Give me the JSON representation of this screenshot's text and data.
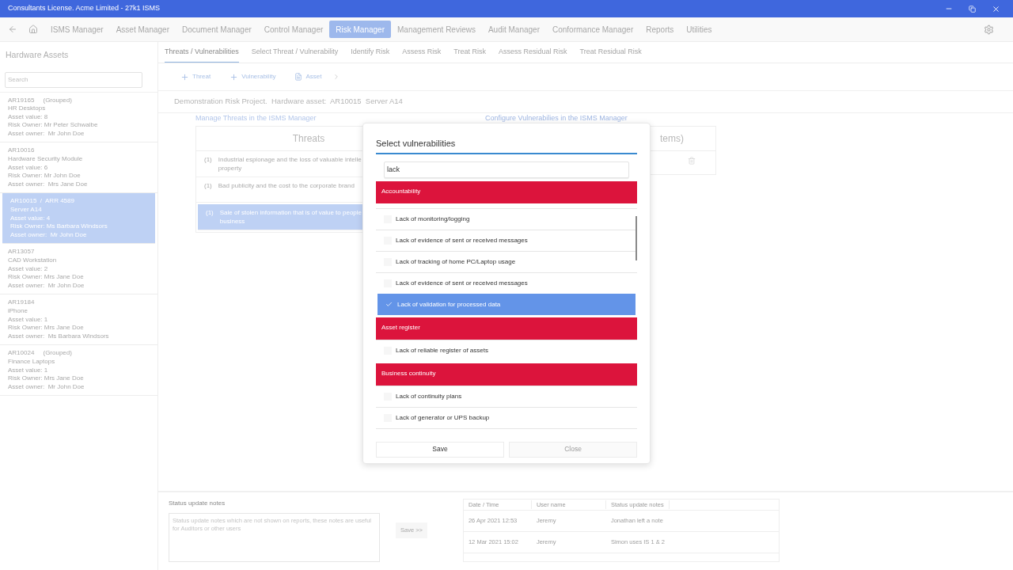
{
  "window": {
    "title": "Consultants License. Acme Limited - 27k1 ISMS"
  },
  "nav": [
    {
      "label": "ISMS Manager",
      "selected": false
    },
    {
      "label": "Asset Manager",
      "selected": false
    },
    {
      "label": "Document Manager",
      "selected": false
    },
    {
      "label": "Control Manager",
      "selected": false
    },
    {
      "label": "Risk Manager",
      "selected": true
    },
    {
      "label": "Management Reviews",
      "selected": false
    },
    {
      "label": "Audit Manager",
      "selected": false
    },
    {
      "label": "Conformance Manager",
      "selected": false
    },
    {
      "label": "Reports",
      "selected": false
    },
    {
      "label": "Utilities",
      "selected": false
    }
  ],
  "sidebar": {
    "title": "Hardware Assets",
    "search": {
      "placeholder": "Search"
    },
    "items": [
      {
        "lines": [
          "AR19165     (Grouped)",
          "HR Desktops",
          "Asset value: 8",
          "Risk Owner: Mr Peter Schwalbe",
          "Asset owner:  Mr John Doe"
        ],
        "selected": false
      },
      {
        "lines": [
          "AR10016",
          "Hardware Security Module",
          "Asset value: 6",
          "Risk Owner: Mr John Doe",
          "Asset owner:  Mrs Jane Doe"
        ],
        "selected": false
      },
      {
        "lines": [
          "AR10015  /  ARR 4589",
          "Server A14",
          "Asset value: 4",
          "Risk Owner: Ms Barbara Windsors",
          "Asset owner:  Mr John Doe"
        ],
        "selected": true
      },
      {
        "lines": [
          "AR13057",
          "CAD Workstation",
          "Asset value: 2",
          "Risk Owner: Mrs Jane Doe",
          "Asset owner:  Mr John Doe"
        ],
        "selected": false
      },
      {
        "lines": [
          "AR19184",
          "iPhone",
          "Asset value: 1",
          "Risk Owner: Mrs Jane Doe",
          "Asset owner:  Ms Barbara Windsors"
        ],
        "selected": false
      },
      {
        "lines": [
          "AR10024     (Grouped)",
          "Finance Laptops",
          "Asset value: 1",
          "Risk Owner: Mrs Jane Doe",
          "Asset owner:  Mr John Doe"
        ],
        "selected": false
      }
    ]
  },
  "tabs": [
    {
      "label": "Threats / Vulnerabilities",
      "selected": true
    },
    {
      "label": "Select Threat / Vulnerability",
      "selected": false
    },
    {
      "label": "Identify Risk",
      "selected": false
    },
    {
      "label": "Assess Risk",
      "selected": false
    },
    {
      "label": "Treat Risk",
      "selected": false
    },
    {
      "label": "Assess Residual Risk",
      "selected": false
    },
    {
      "label": "Treat Residual Risk",
      "selected": false
    }
  ],
  "toolbar": [
    {
      "kind": "plus",
      "label": "Threat"
    },
    {
      "kind": "plus",
      "label": "Vulnerability"
    },
    {
      "kind": "doc",
      "label": "Asset"
    }
  ],
  "project_line": "Demonstration Risk Project.  Hardware asset:  AR10015  Server A14",
  "threats_link": "Manage Threats in the ISMS Manager",
  "vulns_link": "Configure Vulnerabilies in the ISMS Manager",
  "threats": {
    "title": "Threats",
    "rows": [
      {
        "count": "(1)",
        "lines": [
          "Industrial espionage and the loss of valuable intelle",
          "property"
        ],
        "selected": false
      },
      {
        "count": "(1)",
        "lines": [
          "Bad publicity and the cost to the corporate brand"
        ],
        "selected": false
      },
      {
        "count": "(1)",
        "lines": [
          "Sale of stolen information that is of value to people",
          "business"
        ],
        "selected": true
      }
    ]
  },
  "vulns_table": {
    "title": "tems)"
  },
  "dialog": {
    "title": "Select vulnerabilities",
    "search": "lack",
    "items": [
      {
        "kind": "group",
        "label": "Accountability"
      },
      {
        "kind": "item",
        "label": "Lack of monitoring/logging",
        "checked": false
      },
      {
        "kind": "item",
        "label": "Lack of evidence of sent or received messages",
        "checked": false
      },
      {
        "kind": "item",
        "label": "Lack of tracking of home PC/Laptop usage",
        "checked": false
      },
      {
        "kind": "item",
        "label": "Lack of evidence of sent or received messages",
        "checked": false
      },
      {
        "kind": "item",
        "label": "Lack of validation for processed data",
        "checked": true
      },
      {
        "kind": "group",
        "label": "Asset register"
      },
      {
        "kind": "item",
        "label": "Lack of reliable register of assets",
        "checked": false
      },
      {
        "kind": "group",
        "label": "Business continuity"
      },
      {
        "kind": "item",
        "label": "Lack of continuity plans",
        "checked": false
      },
      {
        "kind": "item",
        "label": "Lack of generator or UPS backup",
        "checked": false
      }
    ],
    "buttons": [
      "Save",
      "Close"
    ]
  },
  "status": {
    "label": "Status update notes",
    "placeholder": "Status update notes which are not shown on reports, these notes are useful for Auditors or other users",
    "save": "Save >>",
    "columns": [
      "Date / Time",
      "User name",
      "Status update notes"
    ],
    "rows": [
      [
        "26 Apr 2021 12:53",
        "Jeremy",
        "Jonathan left a note"
      ],
      [
        "12 Mar 2021 15:02",
        "Jeremy",
        "Simon uses IS 1 & 2"
      ]
    ]
  }
}
